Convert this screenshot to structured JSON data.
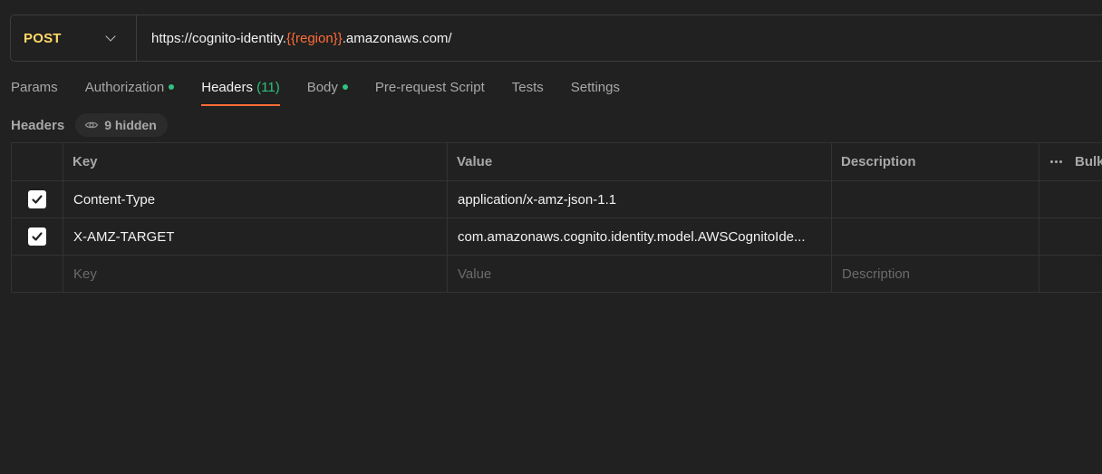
{
  "request": {
    "method": "POST",
    "url_prefix": "https://cognito-identity.",
    "url_variable": "{{region}}",
    "url_suffix": ".amazonaws.com/"
  },
  "tabs": [
    {
      "label": "Params",
      "count": "",
      "dot": false,
      "active": false
    },
    {
      "label": "Authorization",
      "count": "",
      "dot": true,
      "active": false
    },
    {
      "label": "Headers",
      "count": "(11)",
      "dot": false,
      "active": true
    },
    {
      "label": "Body",
      "count": "",
      "dot": true,
      "active": false
    },
    {
      "label": "Pre-request Script",
      "count": "",
      "dot": false,
      "active": false
    },
    {
      "label": "Tests",
      "count": "",
      "dot": false,
      "active": false
    },
    {
      "label": "Settings",
      "count": "",
      "dot": false,
      "active": false
    }
  ],
  "headers_section": {
    "title": "Headers",
    "hidden_label": "9 hidden"
  },
  "table": {
    "columns": {
      "key": "Key",
      "value": "Value",
      "description": "Description",
      "bulk_edit": "Bulk Edit"
    },
    "rows": [
      {
        "key": "Content-Type",
        "value": "application/x-amz-json-1.1",
        "description": "",
        "checked": true
      },
      {
        "key": "X-AMZ-TARGET",
        "value": "com.amazonaws.cognito.identity.model.AWSCognitoIde...",
        "description": "",
        "checked": true
      }
    ],
    "placeholders": {
      "key": "Key",
      "value": "Value",
      "description": "Description"
    }
  },
  "colors": {
    "method": "#ffd966",
    "accent": "#ff6c37",
    "indicator": "#2ec27e"
  }
}
